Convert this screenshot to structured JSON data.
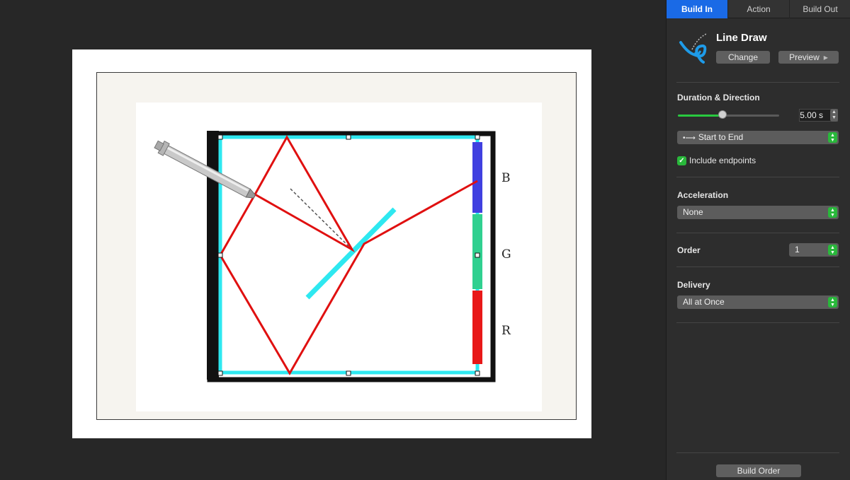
{
  "inspector": {
    "tabs": [
      {
        "label": "Build In",
        "active": true
      },
      {
        "label": "Action",
        "active": false
      },
      {
        "label": "Build Out",
        "active": false
      }
    ],
    "effect": {
      "name": "Line Draw",
      "change_label": "Change",
      "preview_label": "Preview",
      "icon": "line-draw-icon"
    },
    "duration": {
      "title": "Duration & Direction",
      "value": "5.00 s",
      "slider_fraction": 0.44,
      "direction": "Start to End",
      "include_endpoints_label": "Include endpoints",
      "include_endpoints_checked": true
    },
    "acceleration": {
      "title": "Acceleration",
      "value": "None"
    },
    "order": {
      "title": "Order",
      "value": "1"
    },
    "delivery": {
      "title": "Delivery",
      "value": "All at Once"
    },
    "build_order_label": "Build Order"
  },
  "slide": {
    "labels": {
      "b": "B",
      "g": "G",
      "r": "R"
    }
  },
  "colors": {
    "accent": "#1a6ae6",
    "toggle_green": "#29b83b",
    "highlight_cyan": "#2ee8f0",
    "ray_red": "#e01010"
  }
}
